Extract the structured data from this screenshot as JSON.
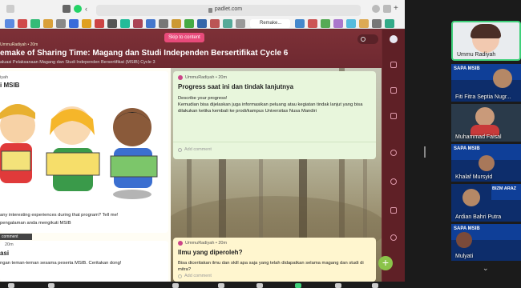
{
  "browser": {
    "url": "padlet.com",
    "active_tab": "Remake..."
  },
  "padlet": {
    "skip_label": "Skip to content",
    "author_top": "UmmuRadiyah • 20m",
    "title": "emake of Sharing Time: Magang dan Studi Independen Bersertifikat Cycle 6",
    "subtitle": "aluasi Pelaksanaan Magang dan Studi Independen Bersertifikat (MSIB) Cycle 3",
    "cards": [
      {
        "author": "UmmuRadiyah • 20m",
        "title": "Progress saat ini dan tindak lanjutnya",
        "body1": "Describe your progress!",
        "body2": "Kemudian bisa dijelaskan juga informasikan peluang atau kegiatan tindak lanjut yang bisa dilakukan ketika kembali ke prodi/kampus Universitas Nusa Mandiri",
        "comment": "Add comment"
      },
      {
        "author": "UmmuRadiyah • 20m",
        "title": "Ilmu yang diperoleh?",
        "body": "Bisa diceritakan ilmu dan skill apa saja yang telah didapatkan selama magang dan studi di mitra?",
        "comment": "Add comment"
      },
      {
        "author": "iyah",
        "title": "i MSIB",
        "body1": "any interesting experiences during that program? Tell me!",
        "body2": "pengalaman anda mengikuti MSIB",
        "comment": "Add comment"
      },
      {
        "author": "20m",
        "title": "asi",
        "body": "ngan teman-teman sesama peserta MSIB. Ceritakan dong!",
        "tag": "comment content"
      }
    ]
  },
  "participants": [
    {
      "name": "Ummu Radiyah"
    },
    {
      "name": "Fiti Fitra Septia Nugr...",
      "banner": "SAPA MSIB"
    },
    {
      "name": "Muhammad Faisal"
    },
    {
      "name": "Khalaf Mursyid",
      "banner": "SAPA MSIB"
    },
    {
      "name": "Ardian Bahri Putra",
      "banner": "BIZM ARAZ"
    },
    {
      "name": "Mulyati",
      "banner": "SAPA MSIB"
    }
  ],
  "colors": {
    "padlet_bg": "#7a2e35",
    "card_yellow": "#fff6cf",
    "card_green": "#e8f6dc",
    "fab": "#8bc34a",
    "skip": "#e84a7a"
  }
}
